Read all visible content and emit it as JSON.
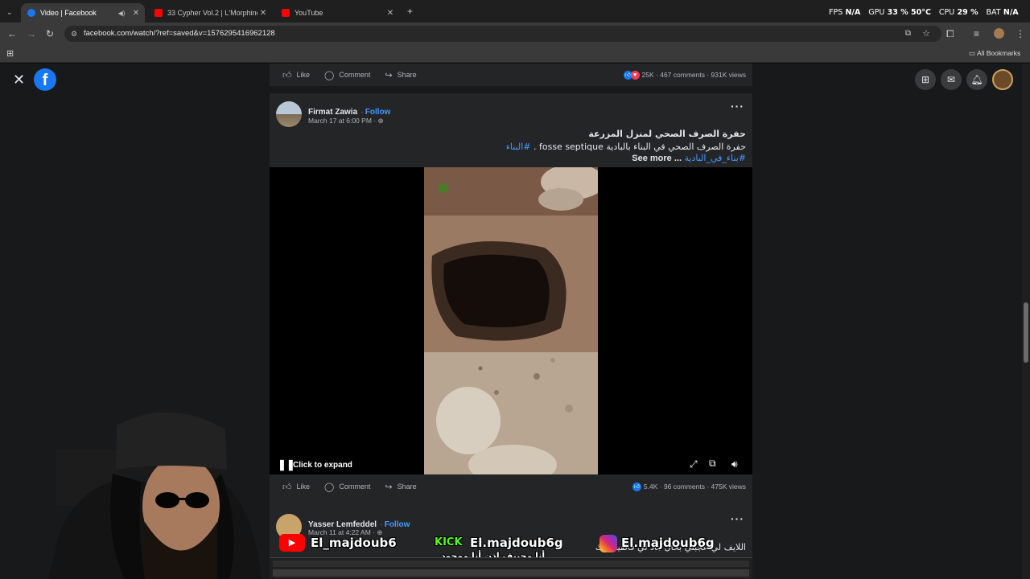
{
  "browser": {
    "tabs": [
      {
        "title": "Video | Facebook",
        "active": true,
        "favicon_color": "#1877f2"
      },
      {
        "title": "33 Cypher Vol.2 | L'Morphine ...",
        "active": false,
        "favicon_color": "#ff0000"
      },
      {
        "title": "YouTube",
        "active": false,
        "favicon_color": "#ff0000"
      }
    ],
    "new_tab_icon": "plus-icon",
    "url": "facebook.com/watch/?ref=saved&v=1576295416962128",
    "all_bookmarks": "All Bookmarks"
  },
  "perf_overlay": {
    "fps_label": "FPS",
    "fps_value": "N/A",
    "gpu_label": "GPU",
    "gpu_value": "33 % 50°C",
    "cpu_label": "CPU",
    "cpu_value": "29 %",
    "bat_label": "BAT",
    "bat_value": "N/A"
  },
  "top_post": {
    "like": "Like",
    "comment": "Comment",
    "share": "Share",
    "reactions": "25K",
    "comments": "467 comments",
    "views": "931K views"
  },
  "post": {
    "author": "Firmat Zawia",
    "follow": "Follow",
    "date": "March 17 at 6:00 PM",
    "title_ar": "حفرة الصرف الصحي لمنزل المزرعة",
    "line2_ar": "حفرة الصرف الصحي في البناء بالبادية fosse septique .",
    "hashtag1": "#البناء",
    "hashtag2": "#بناء_في_البادية",
    "see_more": "... See more",
    "click_to_expand": "Click to expand",
    "like": "Like",
    "comment": "Comment",
    "share": "Share",
    "reactions": "5.4K",
    "comments": "96 comments",
    "views": "475K views"
  },
  "next_post": {
    "author": "Yasser Lemfeddel",
    "follow": "Follow",
    "date": "March 11 at 4:22 AM",
    "text_ar": "اللايف لي عجبني بحال هاد لي فالفيسبوك"
  },
  "stream_overlay": {
    "youtube_handle": "El_majdoub6",
    "kick_label": "KICK",
    "kick_handle": "El.majdoub6g",
    "instagram_handle": "El.majdoub6g",
    "caption_ar": "أنا محبيف إذن أنا موجود"
  },
  "colors": {
    "facebook_blue": "#1877f2",
    "link_blue": "#4599ff",
    "card_bg": "#242526",
    "page_bg": "#18191a",
    "kick_green": "#53fc18"
  }
}
